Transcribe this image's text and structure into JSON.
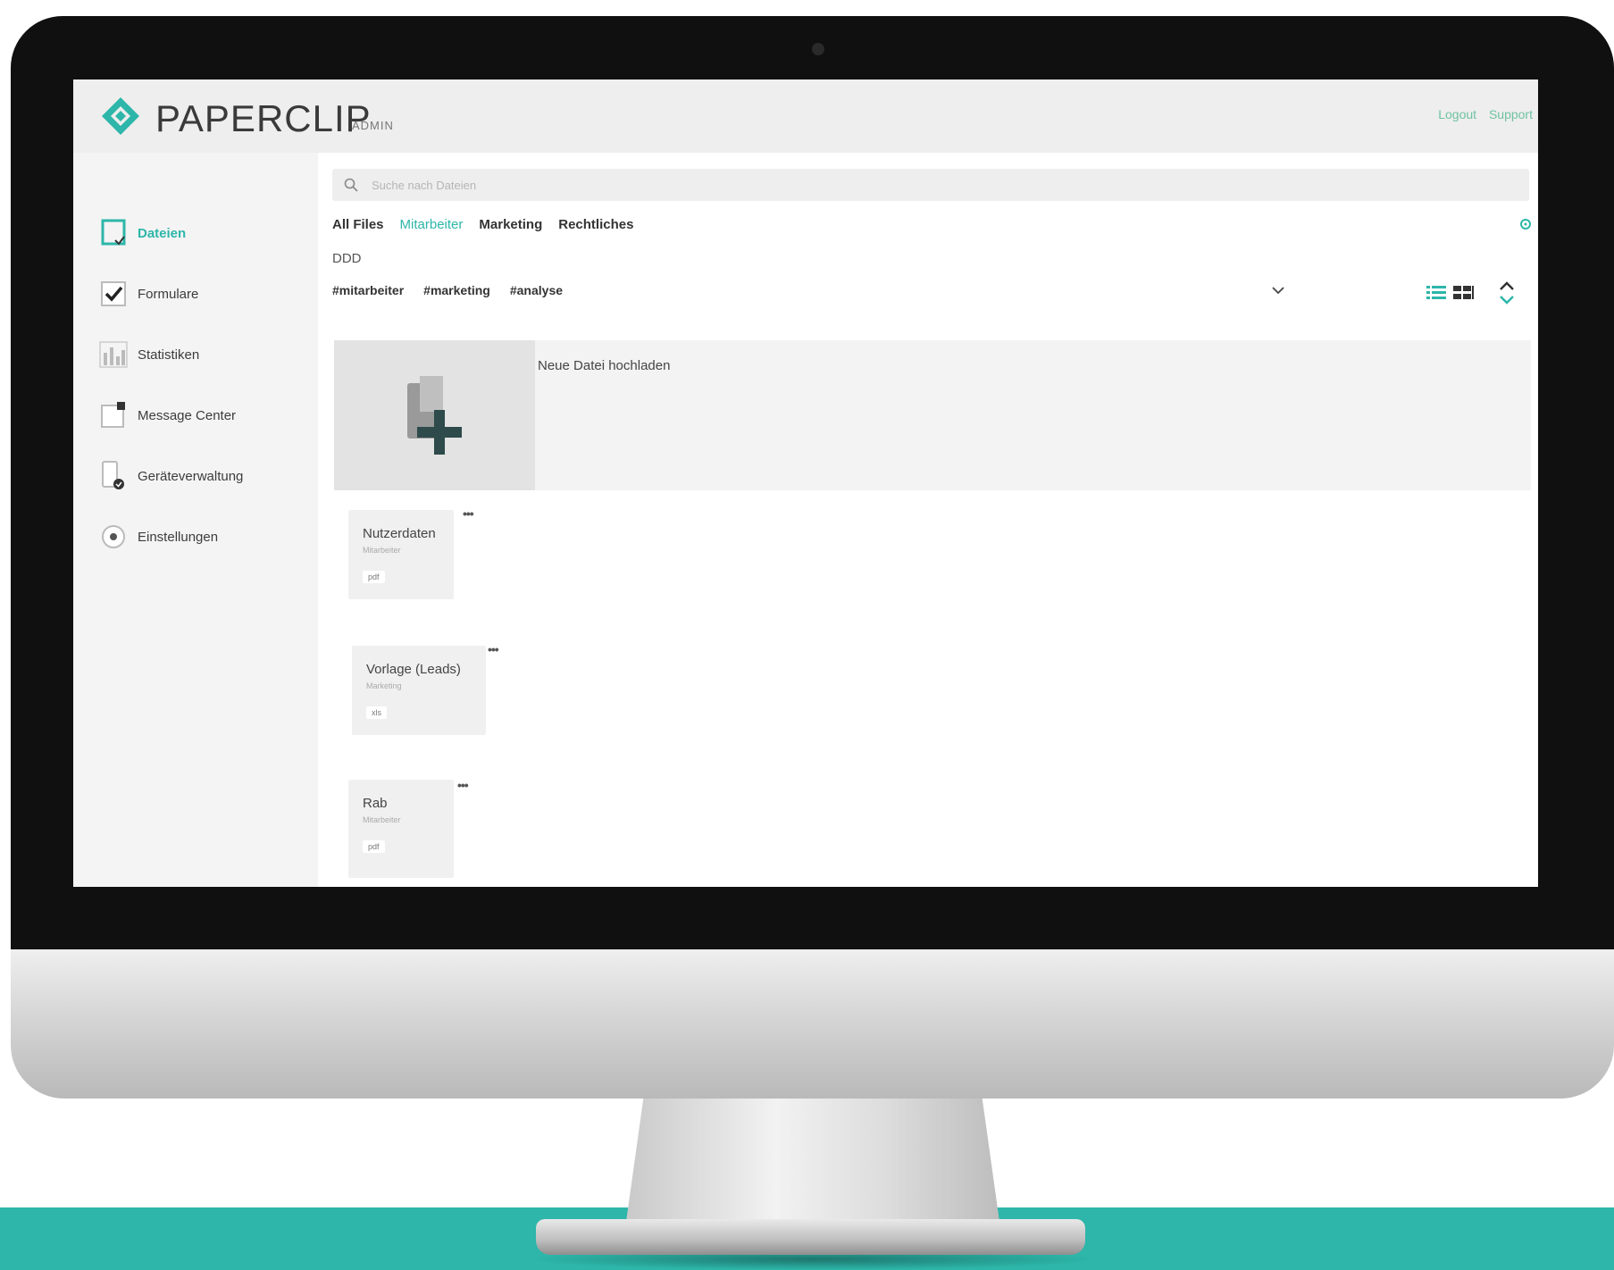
{
  "brand": {
    "name": "PAPERCLIP",
    "subtitle": "ADMIN",
    "accent_color": "#2db6a9",
    "logo_color": "#2db6a9"
  },
  "header": {
    "links": [
      "Logout",
      "Support"
    ]
  },
  "sidebar": {
    "items": [
      {
        "label": "Dateien",
        "icon": "document-icon",
        "active": true
      },
      {
        "label": "Formulare",
        "icon": "checkbox-icon",
        "active": false
      },
      {
        "label": "Statistiken",
        "icon": "bar-chart-icon",
        "active": false
      },
      {
        "label": "Message Center",
        "icon": "message-icon",
        "active": false
      },
      {
        "label": "Geräteverwaltung",
        "icon": "device-icon",
        "active": false
      },
      {
        "label": "Einstellungen",
        "icon": "gear-icon",
        "active": false
      }
    ]
  },
  "search": {
    "placeholder": "Suche nach Dateien"
  },
  "tabs": [
    {
      "label": "All Files",
      "active": false
    },
    {
      "label": "Mitarbeiter",
      "active": true
    },
    {
      "label": "Marketing",
      "active": false
    },
    {
      "label": "Rechtliches",
      "active": false
    }
  ],
  "folder_path": "DDD",
  "tags": [
    "#mitarbeiter",
    "#marketing",
    "#analyse"
  ],
  "upload": {
    "label": "Neue Datei hochladen"
  },
  "files": [
    {
      "name": "Nutzerdaten",
      "meta": "Mitarbeiter",
      "ext": "pdf"
    },
    {
      "name": "Vorlage (Leads)",
      "meta": "Marketing",
      "ext": "xls"
    },
    {
      "name": "Rab",
      "meta": "Mitarbeiter",
      "ext": "pdf"
    }
  ]
}
